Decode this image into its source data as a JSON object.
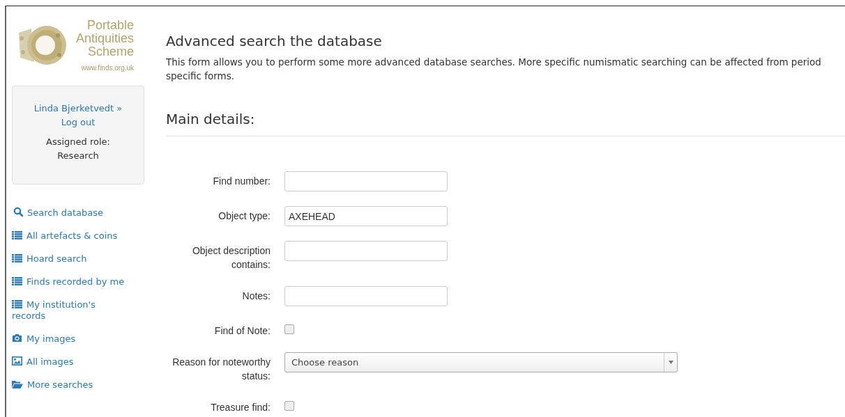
{
  "logo": {
    "title_lines": [
      "Portable",
      "Antiquities",
      "Scheme"
    ],
    "url": "www.finds.org.uk"
  },
  "user_box": {
    "user": "Linda Bjerketvedt",
    "separator": "»",
    "logout": "Log out",
    "role_label": "Assigned role:",
    "role": "Research"
  },
  "sidebar": {
    "items": [
      {
        "label": "Search database",
        "kind": "search"
      },
      {
        "label": "All artefacts & coins",
        "kind": "list"
      },
      {
        "label": "Hoard search",
        "kind": "list"
      },
      {
        "label": "Finds recorded by me",
        "kind": "list"
      },
      {
        "label": "My institution's records",
        "kind": "list"
      },
      {
        "label": "My images",
        "kind": "camera"
      },
      {
        "label": "All images",
        "kind": "image"
      },
      {
        "label": "More searches",
        "kind": "folder"
      }
    ]
  },
  "page": {
    "title": "Advanced search the database",
    "intro": "This form allows you to perform some more advanced database searches. More specific numismatic searching can be affected from period specific forms."
  },
  "section": {
    "title": "Main details:"
  },
  "fields": [
    {
      "kind": "text",
      "label": "Find number:"
    },
    {
      "kind": "text",
      "label": "Object type:",
      "value": "AXEHEAD"
    },
    {
      "kind": "text",
      "label": "Object description contains:"
    },
    {
      "kind": "text",
      "label": "Notes:"
    },
    {
      "kind": "checkbox",
      "label": "Find of Note:",
      "checked": false
    },
    {
      "kind": "select",
      "label": "Reason for noteworthy status:",
      "value": "Choose reason"
    },
    {
      "kind": "checkbox",
      "label": "Treasure find:",
      "checked": false
    }
  ]
}
